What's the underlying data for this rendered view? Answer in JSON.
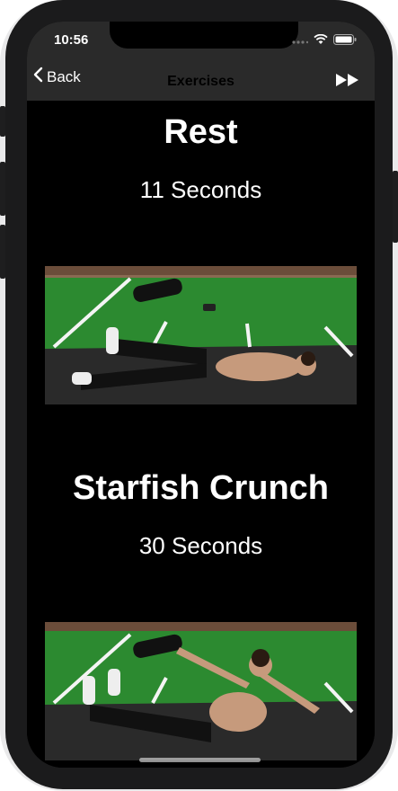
{
  "status_bar": {
    "time": "10:56"
  },
  "nav": {
    "back_label": "Back",
    "title": "Exercises"
  },
  "exercises": [
    {
      "name": "Rest",
      "duration": "11 Seconds"
    },
    {
      "name": "Starfish Crunch",
      "duration": "30 Seconds"
    }
  ],
  "colors": {
    "bar": "#2a2a2a",
    "background": "#000000",
    "text": "#ffffff",
    "turf": "#2b8d33",
    "floor": "#2b2b2b"
  }
}
